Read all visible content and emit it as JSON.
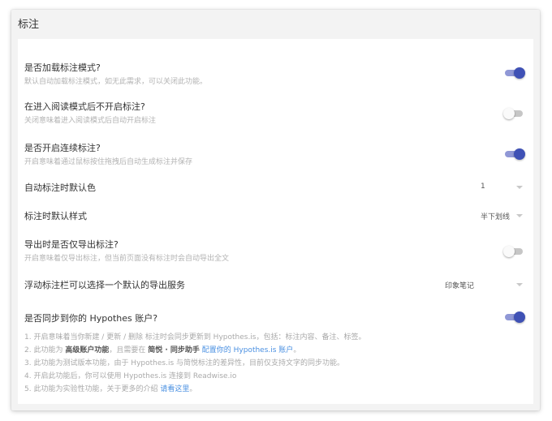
{
  "window": {
    "title": "标注"
  },
  "settings": [
    {
      "title": "是否加载标注模式?",
      "desc": "默认自动加载标注模式，如无此需求，可以关闭此功能。",
      "enabled": true
    },
    {
      "title": "在进入阅读模式后不开启标注?",
      "desc": "关闭意味着进入阅读模式后自动开启标注",
      "enabled": false
    },
    {
      "title": "是否开启连续标注?",
      "desc": "开启意味着通过鼠标按住拖拽后自动生成标注并保存",
      "enabled": true
    },
    {
      "title": "自动标注时默认色",
      "value": "1"
    },
    {
      "title": "标注时默认样式",
      "value": "半下划线"
    },
    {
      "title": "导出时是否仅导出标注?",
      "desc": "开启意味着仅导出标注，但当前页面没有标注时会自动导出全文",
      "enabled": false
    },
    {
      "title": "浮动标注栏可以选择一个默认的导出服务",
      "value": "印象笔记"
    },
    {
      "title": "是否同步到你的 Hypothes 账户?",
      "enabled": true
    }
  ],
  "notes": {
    "n1": "1. 开启意味着当你新建 / 更新 / 删除 标注时会同步更新到 Hypothes.is，包括：标注内容、备注、标签。",
    "n2_pre": "2. 此功能为 ",
    "n2_bold1": "高级账户功能",
    "n2_mid": "，且需要在 ",
    "n2_bold2": "简悦 · 同步助手",
    "n2_space": " ",
    "n2_link": "配置你的 Hypothes.is 账户",
    "n2_end": "。",
    "n3": "3. 此功能为测试版本功能，由于 Hypothes.is 与简悦标注的差异性，目前仅支持文字的同步功能。",
    "n4": "4. 开启此功能后，你可以使用 Hypothes.is 连接到 Readwise.io",
    "n5_pre": "5. 此功能为实验性功能，关于更多的介绍 ",
    "n5_link": "请看这里",
    "n5_end": "。"
  }
}
